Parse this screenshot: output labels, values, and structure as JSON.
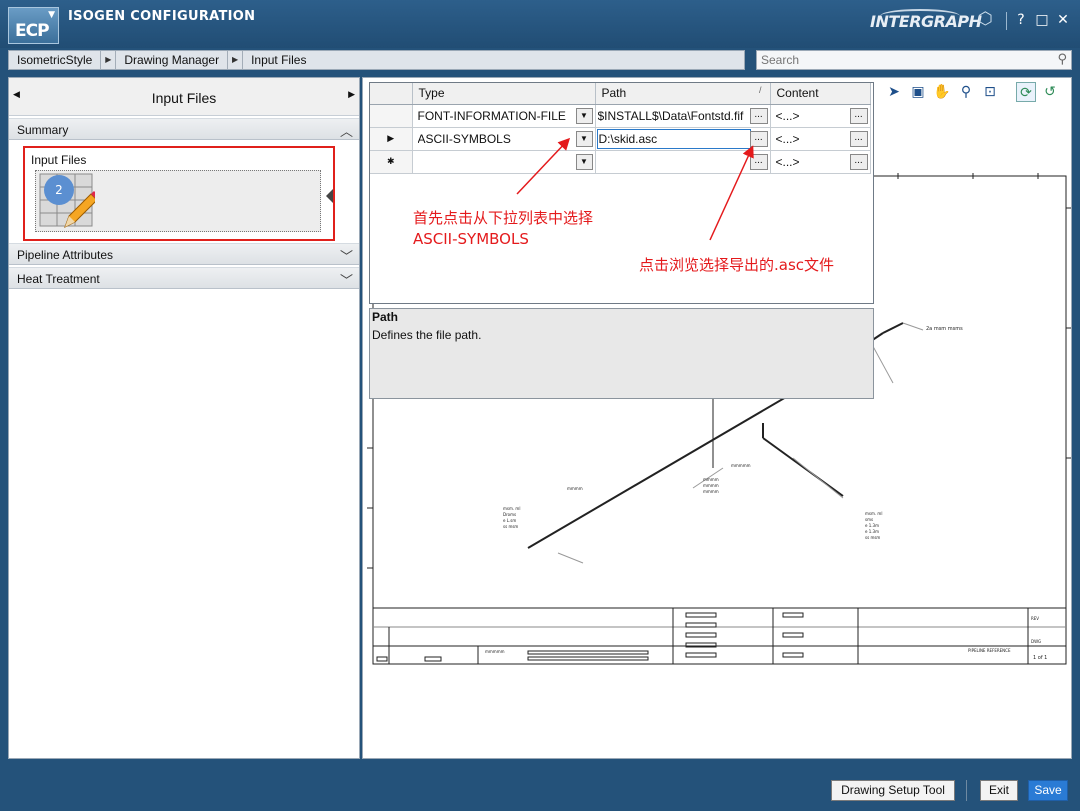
{
  "window": {
    "logo": "ECP",
    "title": "ISOGEN CONFIGURATION",
    "brand": "INTERGRAPH",
    "help_label": "?",
    "maximize_label": "□",
    "close_label": "✕"
  },
  "breadcrumb": {
    "items": [
      "IsometricStyle",
      "Drawing Manager",
      "Input Files"
    ],
    "separator": "▶"
  },
  "search": {
    "placeholder": "Search"
  },
  "left_panel": {
    "title": "Input Files",
    "sections": {
      "summary": "Summary",
      "pipeline": "Pipeline Attributes",
      "heat": "Heat Treatment"
    },
    "summary_tile": {
      "label": "Input Files",
      "count": "2"
    },
    "chevron_up": "︿",
    "chevron_down": "﹀"
  },
  "grid": {
    "columns": {
      "type": "Type",
      "path": "Path",
      "sort_mark": "/",
      "content": "Content"
    },
    "rows": [
      {
        "marker": "",
        "type": "FONT-INFORMATION-FILE",
        "path": "$INSTALL$\\Data\\Fontstd.fif",
        "content": "<...>"
      },
      {
        "marker": "▶",
        "type": "ASCII-SYMBOLS",
        "path": "D:\\skid.asc",
        "content": "<...>"
      },
      {
        "marker": "✱",
        "type": "",
        "path": "",
        "content": "<...>"
      }
    ],
    "dropdown_glyph": "▼",
    "browse_glyph": "..."
  },
  "help": {
    "title": "Path",
    "description": "Defines the file path."
  },
  "annotations": {
    "step1_line1": "首先点击从下拉列表中选择",
    "step1_line2": "ASCII-SYMBOLS",
    "step2": "点击浏览选择导出的.asc文件",
    "color": "#e41a1c"
  },
  "buttons": {
    "setup": "Drawing Setup Tool",
    "exit": "Exit",
    "save": "Save"
  },
  "colors": {
    "chrome": "#24527a",
    "accent_save": "#2a7bd5",
    "highlight": "#e0201b"
  }
}
